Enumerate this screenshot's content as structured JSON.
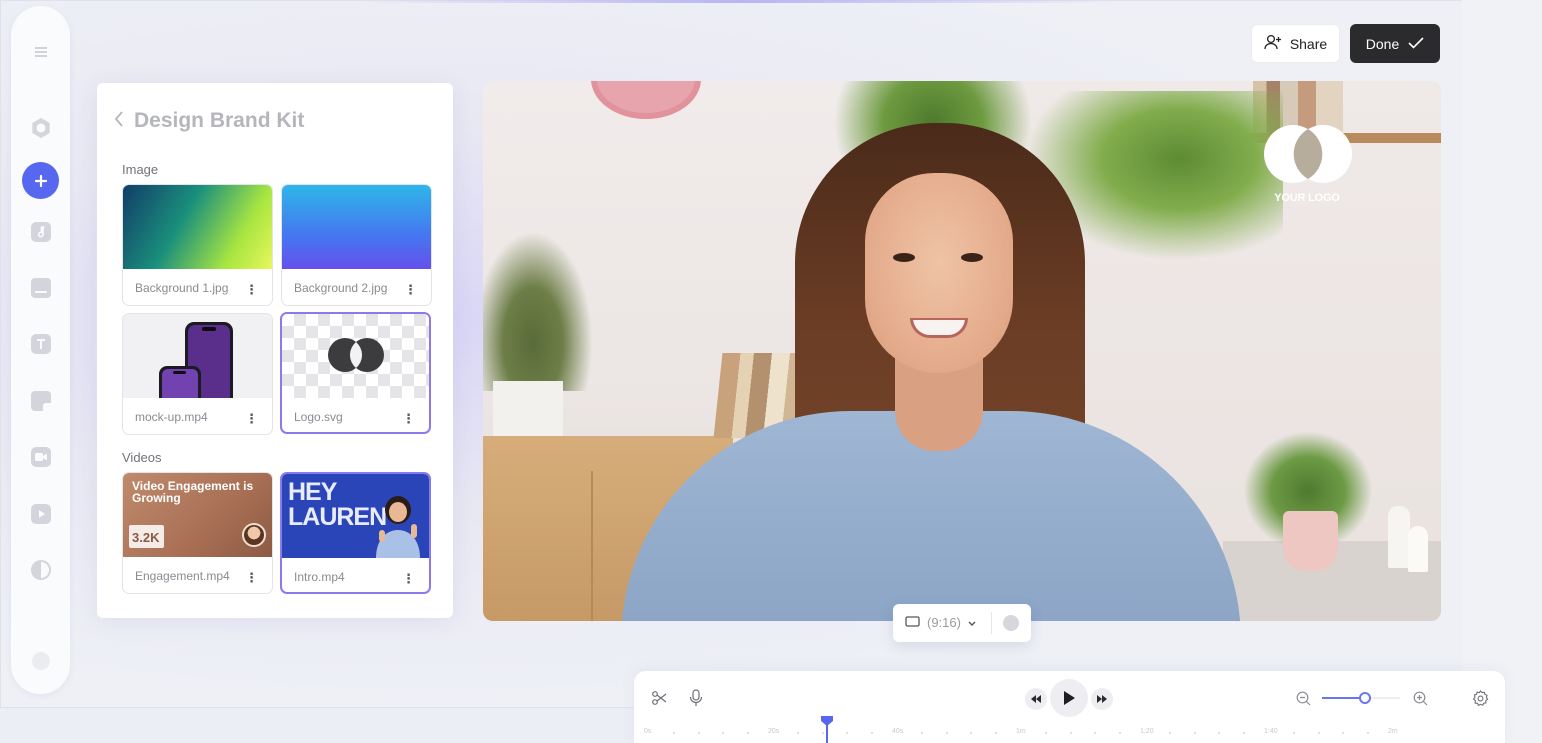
{
  "header": {
    "share_label": "Share",
    "done_label": "Done"
  },
  "sidebar": {
    "items": [
      {
        "name": "menu-icon"
      },
      {
        "name": "record-icon"
      },
      {
        "name": "add-icon",
        "active": true
      },
      {
        "name": "music-icon"
      },
      {
        "name": "subtitles-icon"
      },
      {
        "name": "text-icon"
      },
      {
        "name": "sticker-icon"
      },
      {
        "name": "camera-icon"
      },
      {
        "name": "video-icon"
      },
      {
        "name": "filter-icon"
      },
      {
        "name": "help-icon"
      }
    ]
  },
  "brand_kit": {
    "title": "Design Brand Kit",
    "image_section": "Image",
    "videos_section": "Videos",
    "images": [
      {
        "name": "Background 1.jpg"
      },
      {
        "name": "Background 2.jpg"
      },
      {
        "name": "mock-up.mp4"
      },
      {
        "name": "Logo.svg",
        "selected": true
      }
    ],
    "videos": [
      {
        "name": "Engagement.mp4",
        "thumb_title": "Video Engagement is Growing",
        "thumb_number": "3.2K"
      },
      {
        "name": "Intro.mp4",
        "thumb_title_line1": "HEY",
        "thumb_title_line2": "LAUREN",
        "selected": true
      }
    ]
  },
  "preview": {
    "logo_text": "YOUR LOGO",
    "aspect_ratio": "(9:16)"
  },
  "timeline": {
    "zoom_level": 0.55,
    "ruler_labels": [
      "0s",
      "20s",
      "40s",
      "1m",
      "1:20",
      "1:40",
      "2m"
    ]
  },
  "colors": {
    "accent": "#5867f0",
    "selected_border": "#8a7af0",
    "done_bg": "#2b2b2d"
  }
}
